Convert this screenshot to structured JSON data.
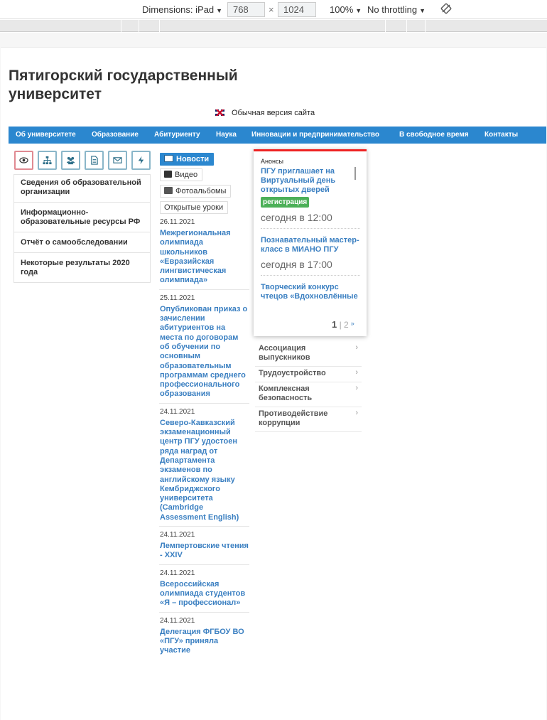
{
  "devtools": {
    "dimensions_label": "Dimensions: iPad",
    "width": "768",
    "height": "1024",
    "zoom": "100%",
    "throttling": "No throttling",
    "rotate_icon": "rotate-icon"
  },
  "site": {
    "title": "Пятигорский государственный университет",
    "version_link": "Обычная версия сайта",
    "flag_icon": "uk-flag-icon"
  },
  "nav": {
    "items": [
      "Об университете",
      "Образование",
      "Абитуриенту",
      "Наука",
      "Инновации и предпринимательство",
      "В свободное время",
      "Контакты"
    ]
  },
  "accessibility": {
    "icons": [
      "eye-icon",
      "sitemap-icon",
      "users-icon",
      "document-icon",
      "envelope-icon",
      "bolt-icon"
    ]
  },
  "left_menu": {
    "items": [
      "Сведения об образовательной организации",
      "Информационно-образовательные ресурсы РФ",
      "Отчёт о самообследовании",
      "Некоторые результаты 2020 года"
    ]
  },
  "tabs": {
    "items": [
      "Новости",
      "Видео",
      "Фотоальбомы",
      "Открытые уроки"
    ],
    "active": "Новости"
  },
  "news": [
    {
      "date": "26.11.2021",
      "title": "Межрегиональная олимпиада школьников «Евразийская лингвистическая олимпиада»"
    },
    {
      "date": "25.11.2021",
      "title": "Опубликован приказ о зачислении абитуриентов на места по договорам об обучении по основным образовательным программам среднего профессионального образования"
    },
    {
      "date": "24.11.2021",
      "title": "Северо-Кавказский экзаменационный центр ПГУ удостоен ряда наград от Департамента экзаменов по английскому языку Кембриджского университета (Cambridge Assessment English)"
    },
    {
      "date": "24.11.2021",
      "title": "Лемпертовские чтения - XXIV"
    },
    {
      "date": "24.11.2021",
      "title": "Всероссийская олимпиада студентов «Я – профессионал»"
    },
    {
      "date": "24.11.2021",
      "title": "Делегация ФГБОУ ВО «ПГУ» приняла участие"
    }
  ],
  "announcements": {
    "header": "Анонсы",
    "items": [
      {
        "title": "ПГУ приглашает на Виртуальный день открытых дверей",
        "tag": "регистрация",
        "time": "сегодня в 12:00"
      },
      {
        "title": "Познавательный мастер-класс в МИАНО ПГУ",
        "tag": "",
        "time": "сегодня в 17:00"
      },
      {
        "title": "Творческий конкурс чтецов «Вдохновлённые",
        "tag": "",
        "time": ""
      }
    ],
    "page_current": "1",
    "page_other": "2"
  },
  "right_menu": {
    "items": [
      "Ассоциация выпускников",
      "Трудоустройство",
      "Комплексная безопасность",
      "Противодействие коррупции"
    ]
  },
  "colors": {
    "nav_bg": "#2b87cf",
    "link": "#3a7fc1",
    "tag_bg": "#4cb058",
    "ann_accent": "#e22222"
  }
}
